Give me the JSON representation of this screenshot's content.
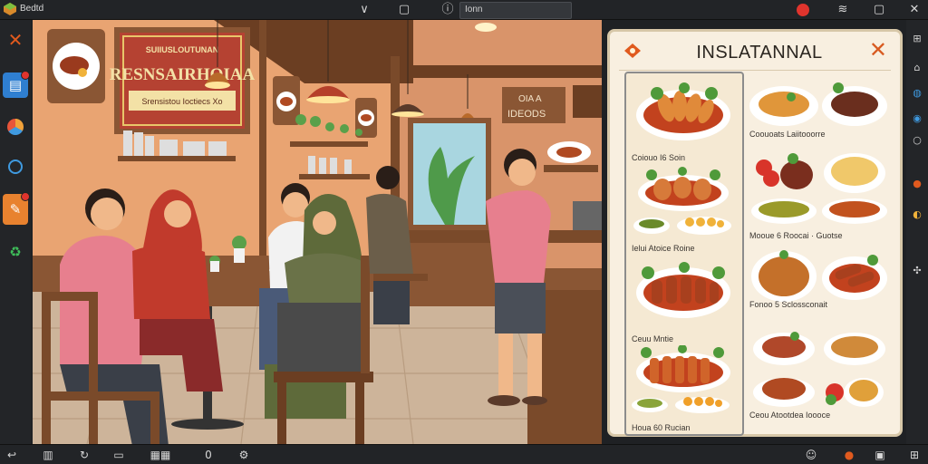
{
  "window": {
    "title": "Bedtd",
    "address": "Ionn"
  },
  "topbar": {
    "icons": [
      "app-logo",
      "chevron-down-icon",
      "square-icon",
      "info-icon",
      "record-icon",
      "wifi-icon",
      "copy-icon",
      "close-icon"
    ]
  },
  "leftrail": {
    "icons": [
      "close-icon",
      "document-icon",
      "browser-icon",
      "eye-icon",
      "tools-icon",
      "recycle-icon"
    ]
  },
  "rightrail": {
    "icons": [
      "grid-icon",
      "home-icon",
      "refresh-icon",
      "settings-icon",
      "dot-icon",
      "alert-icon",
      "info-icon",
      "link-icon"
    ]
  },
  "bottombar": {
    "icons": [
      "back-icon",
      "bar-chart-icon",
      "refresh-icon",
      "window-icon",
      "grid-icon",
      "zero-icon",
      "settings-icon",
      "smile-icon",
      "alert-icon",
      "message-icon",
      "grid2-icon"
    ]
  },
  "scene": {
    "sign_top": "SUIIUSLOUTUNAN",
    "sign_main": "RESNSAIRHOIAA",
    "sign_sub": "Srensistou Ioctiecs   Xo",
    "wall_sign_1": "OIA A",
    "wall_sign_2": "IDEODS"
  },
  "menu": {
    "title": "INSLATANNAL",
    "left_items": [
      {
        "name": "Coiouo  I6 Soin"
      },
      {
        "name": "Ielui Atoice  Roine"
      },
      {
        "name": "Ceuu Mntie"
      },
      {
        "name": "Houa  60 Rucian"
      }
    ],
    "right_items": [
      {
        "name": "Coouoats Laiitooorre"
      },
      {
        "name": "Mooue  6 Roocai  · Guotse"
      },
      {
        "name": "Fonoo  5 Sclossconait"
      },
      {
        "name": "Ceou Atootdea Ioooce"
      }
    ]
  },
  "colors": {
    "accent": "#e05a1e",
    "panel": "#f8efe0",
    "wall": "#e9a472",
    "wood": "#7a4a2a"
  }
}
